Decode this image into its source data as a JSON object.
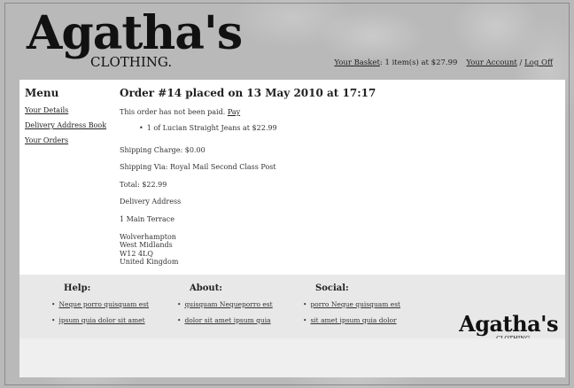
{
  "brand": {
    "name": "Agatha's",
    "sub": "CLOTHING."
  },
  "header": {
    "basket_label": "Your Basket",
    "basket_summary": ": 1 item(s) at $27.99",
    "account_label": "Your Account",
    "separator": "/",
    "logoff_label": "Log Off"
  },
  "menu": {
    "title": "Menu",
    "items": [
      {
        "label": "Your Details"
      },
      {
        "label": "Delivery Address Book"
      },
      {
        "label": "Your Orders"
      }
    ]
  },
  "order": {
    "title": "Order #14 placed on 13 May 2010 at 17:17",
    "status_text": "This order has not been paid.",
    "pay_label": "Pay",
    "items": [
      "1 of Lucian Straight Jeans at $22.99"
    ],
    "shipping_charge": "Shipping Charge: $0.00",
    "shipping_via": "Shipping Via: Royal Mail Second Class Post",
    "total": "Total: $22.99",
    "delivery_heading": "Delivery Address",
    "address_line1": "1 Main Terrace",
    "address_lines": [
      "Wolverhampton",
      "West Midlands",
      "W12 4LQ",
      "United Kingdom"
    ]
  },
  "footer": {
    "columns": [
      {
        "title": "Help:",
        "links": [
          "Neque porro quisquam est",
          "ipsum quia dolor sit amet"
        ]
      },
      {
        "title": "About:",
        "links": [
          "quisquam Nequeporro est",
          "dolor sit amet ipsum quia"
        ]
      },
      {
        "title": "Social:",
        "links": [
          "porro Neque quisquam est",
          "sit amet ipsum quia dolor"
        ]
      }
    ]
  }
}
